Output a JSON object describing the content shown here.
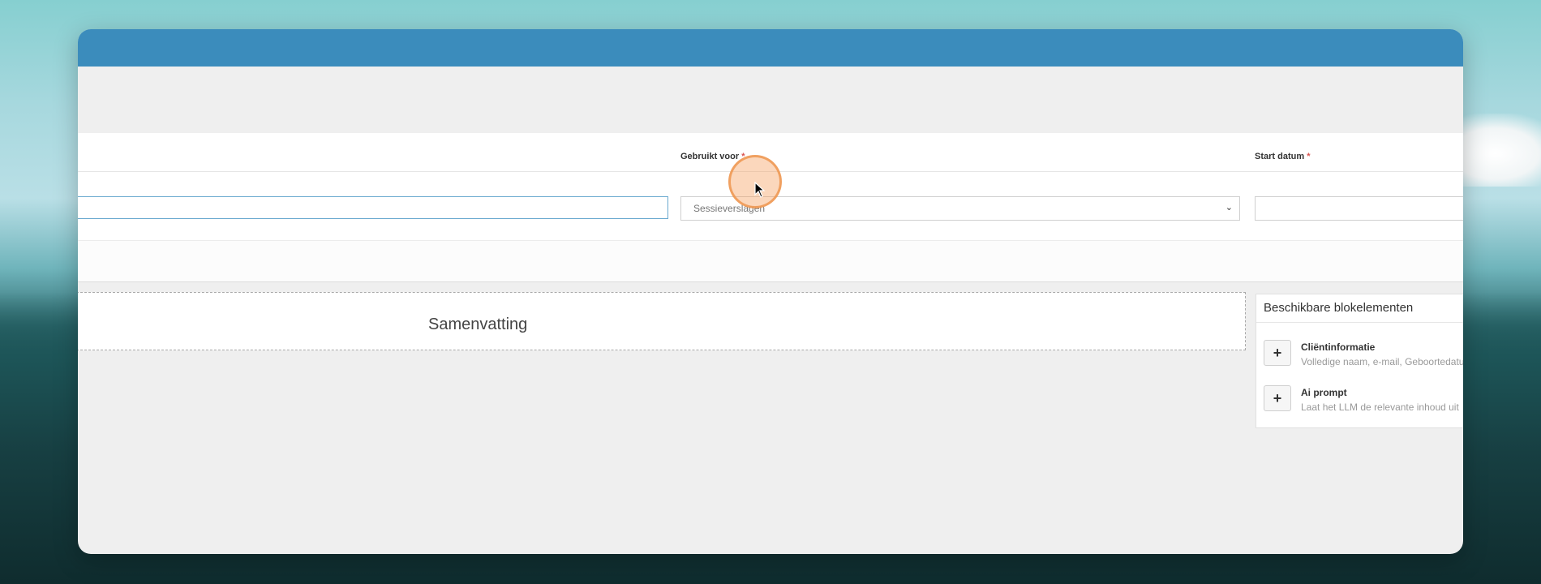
{
  "form": {
    "used_for": {
      "label": "Gebruikt voor",
      "required_mark": "*",
      "selected": "Sessieverslagen"
    },
    "start_date": {
      "label": "Start datum",
      "required_mark": "*",
      "value": ""
    },
    "name_value": ""
  },
  "canvas": {
    "summary_block_title": "Samenvatting"
  },
  "blocks_panel": {
    "title": "Beschikbare blokelementen",
    "items": [
      {
        "name": "Cliëntinformatie",
        "description": "Volledige naam, e-mail, Geboortedatum",
        "icon": "plus-icon"
      },
      {
        "name": "Ai prompt",
        "description": "Laat het LLM de relevante inhoud uit",
        "icon": "plus-icon"
      }
    ]
  },
  "colors": {
    "titlebar": "#3b8cbc",
    "required": "#d9534f",
    "cursor_highlight": "#f5a05f"
  }
}
